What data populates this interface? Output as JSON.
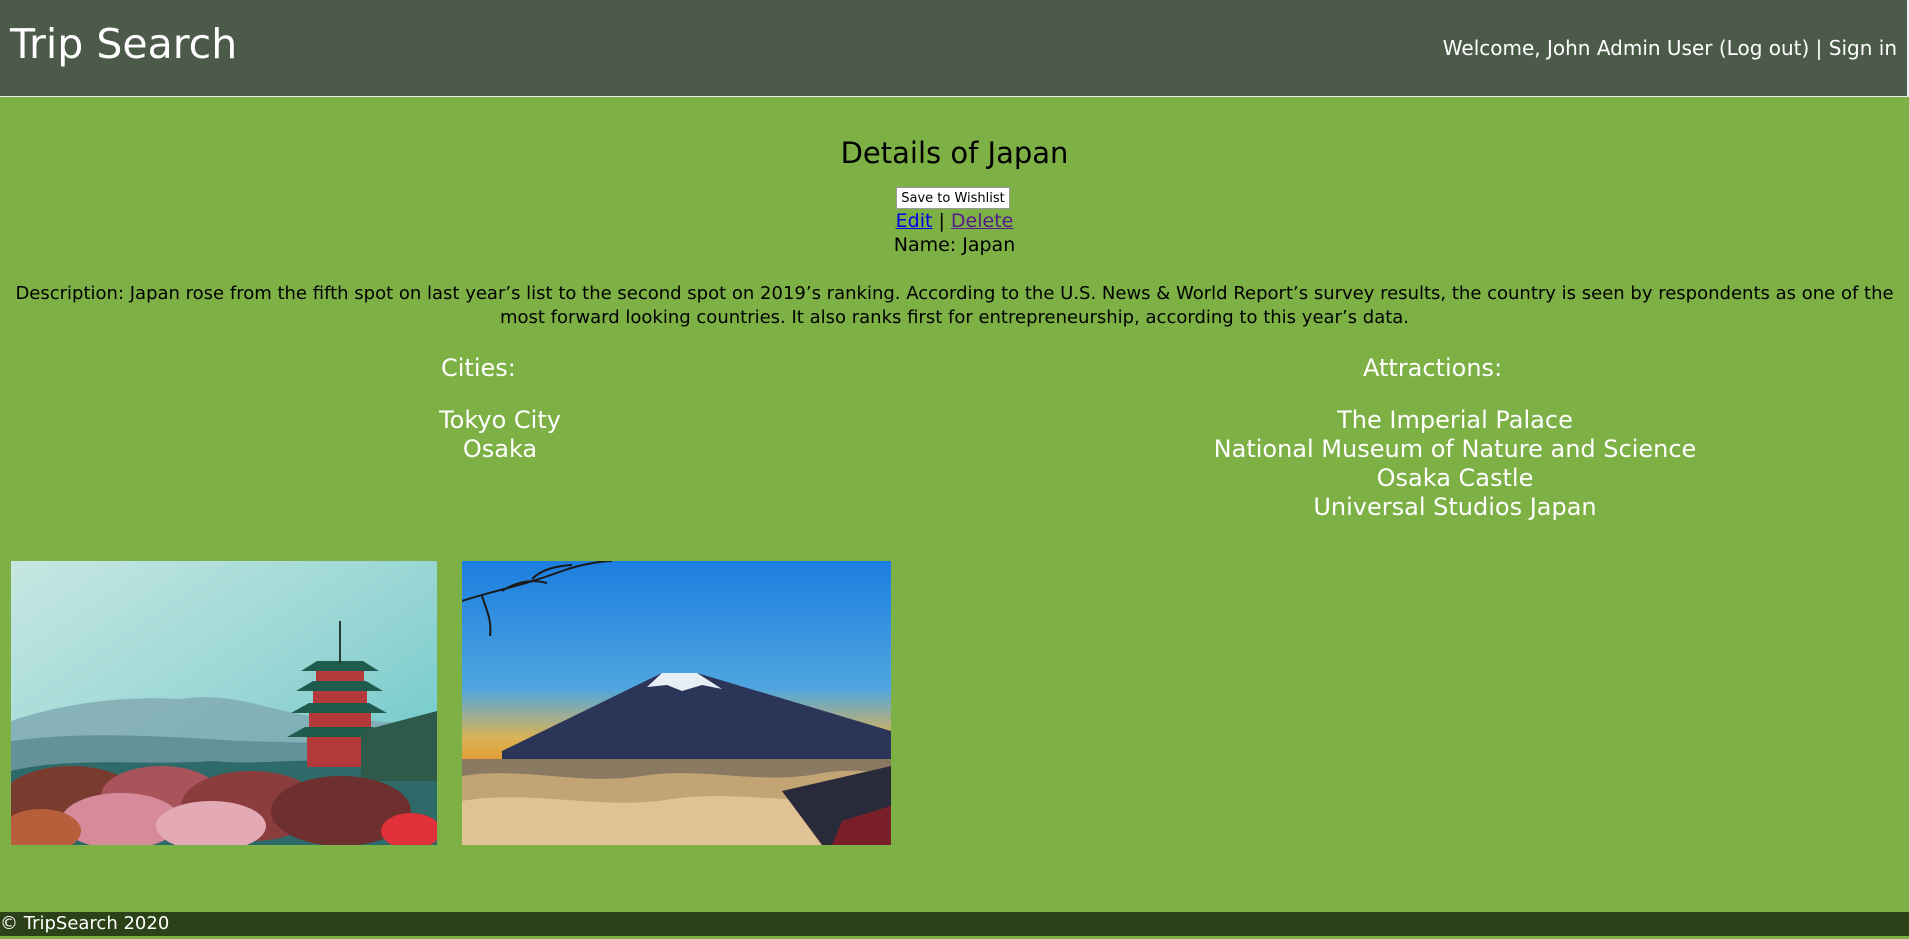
{
  "header": {
    "brand": "Trip Search",
    "welcome_text": "Welcome, John Admin User ",
    "logout_label": "(Log out)",
    "separator": " | ",
    "signin_label": "Sign in"
  },
  "page": {
    "title": "Details of Japan",
    "wishlist_button": "Save to Wishlist",
    "edit_label": "Edit",
    "action_separator": " | ",
    "delete_label": "Delete",
    "name_line": "Name: Japan",
    "description": "Description: Japan rose from the fifth spot on last year’s list to the second spot on 2019’s ranking. According to the U.S. News & World Report’s survey results, the country is seen by respondents as one of the most forward looking countries. It also ranks first for entrepreneurship, according to this year’s data."
  },
  "cities": {
    "heading": "Cities:",
    "items": [
      "Tokyo City",
      "Osaka"
    ]
  },
  "attractions": {
    "heading": "Attractions:",
    "items": [
      "The Imperial Palace",
      "National Museum of Nature and Science",
      "Osaka Castle",
      "Universal Studios Japan"
    ]
  },
  "photos": [
    {
      "subject": "pagoda-with-cherry-blossoms"
    },
    {
      "subject": "mount-fuji-above-clouds"
    }
  ],
  "footer": {
    "copyright": "© TripSearch 2020"
  },
  "colors": {
    "header_bg": "#4b5a49",
    "page_bg": "#7db045",
    "footer_bg": "#2b4117"
  }
}
